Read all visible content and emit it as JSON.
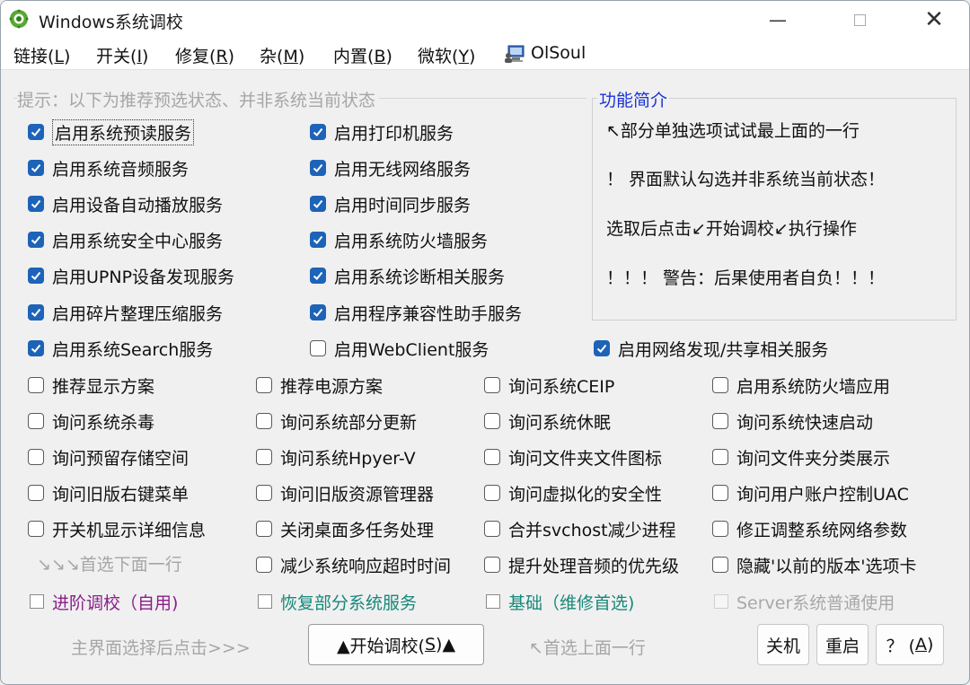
{
  "window": {
    "title": "Windows系统调校",
    "controls": {
      "minimize": "—",
      "close": "✕"
    }
  },
  "menu": [
    {
      "label": "链接",
      "accel": "L"
    },
    {
      "label": "开关",
      "accel": "I"
    },
    {
      "label": "修复",
      "accel": "R"
    },
    {
      "label": "杂",
      "accel": "M"
    },
    {
      "label": "内置",
      "accel": "B"
    },
    {
      "label": "微软",
      "accel": "Y"
    }
  ],
  "user": {
    "name": "OlSoul",
    "icon": "computer-user-icon"
  },
  "hint": "提示：以下为推荐预选状态、并非系统当前状态",
  "services": [
    {
      "label": "启用系统预读服务",
      "checked": true
    },
    {
      "label": "启用打印机服务",
      "checked": true
    },
    {
      "label": "启用系统音频服务",
      "checked": true
    },
    {
      "label": "启用无线网络服务",
      "checked": true
    },
    {
      "label": "启用设备自动播放服务",
      "checked": true
    },
    {
      "label": "启用时间同步服务",
      "checked": true
    },
    {
      "label": "启用系统安全中心服务",
      "checked": true
    },
    {
      "label": "启用系统防火墙服务",
      "checked": true
    },
    {
      "label": "启用UPNP设备发现服务",
      "checked": true
    },
    {
      "label": "启用系统诊断相关服务",
      "checked": true
    },
    {
      "label": "启用碎片整理压缩服务",
      "checked": true
    },
    {
      "label": "启用程序兼容性助手服务",
      "checked": true
    },
    {
      "label": "启用系统Search服务",
      "checked": true
    },
    {
      "label": "启用WebClient服务",
      "checked": false
    },
    {
      "label": "启用网络发现/共享相关服务",
      "checked": true
    }
  ],
  "info_panel": {
    "title": "功能简介",
    "lines": [
      "↖部分单独选项试试最上面的一行",
      "！ 界面默认勾选并非系统当前状态！",
      "选取后点击↙开始调校↙执行操作",
      "！！！ 警告：后果使用者自负！！！"
    ]
  },
  "options": [
    "推荐显示方案",
    "推荐电源方案",
    "询问系统CEIP",
    "启用系统防火墙应用",
    "询问系统杀毒",
    "询问系统部分更新",
    "询问系统休眠",
    "询问系统快速启动",
    "询问预留存储空间",
    "询问系统Hpyer-V",
    "询问文件夹文件图标",
    "询问文件夹分类展示",
    "询问旧版右键菜单",
    "询问旧版资源管理器",
    "询问虚拟化的安全性",
    "询问用户账户控制UAC",
    "开关机显示详细信息",
    "关闭桌面多任务处理",
    "合并svchost减少进程",
    "修正调整系统网络参数",
    "减少系统响应超时时间",
    "提升处理音频的优先级",
    "隐藏'以前的版本'选项卡"
  ],
  "select_below_hint": "↘↘↘首选下面一行",
  "presets": [
    {
      "label": "进阶调校（自用)",
      "color": "#8a1d8a"
    },
    {
      "label": "恢复部分系统服务",
      "color": "#17887a"
    },
    {
      "label": "基础（维修首选)",
      "color": "#17887a"
    },
    {
      "label": "Server系统普通使用",
      "color": "#a8a8a8",
      "disabled": true
    }
  ],
  "footer": {
    "hint_left": "主界面选择后点击>>>",
    "start_button": {
      "prefix": "▲开始调校(",
      "accel": "S",
      "suffix": ")▲"
    },
    "hint_right": "↖首选上面一行",
    "shutdown": "关机",
    "restart": "重启",
    "help": {
      "prefix": "？ (",
      "accel": "A",
      "suffix": ")"
    }
  },
  "colors": {
    "checkbox_checked": "#1d63b8",
    "panel_title": "#1a33d6"
  }
}
